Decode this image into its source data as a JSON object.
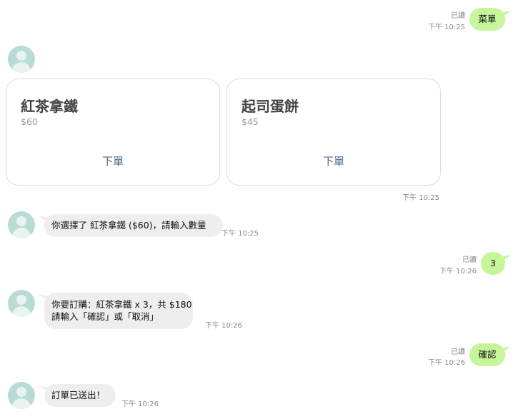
{
  "messages": {
    "out1": {
      "text": "菜單",
      "read": "已讀",
      "time": "下午 10:25"
    },
    "menu": {
      "cards": [
        {
          "title": "紅茶拿鐵",
          "price": "$60",
          "button": "下單"
        },
        {
          "title": "起司蛋餅",
          "price": "$45",
          "button": "下單"
        }
      ],
      "time": "下午 10:25"
    },
    "in1": {
      "text": "你選擇了 紅茶拿鐵 ($60)，請輸入數量",
      "time": "下午 10:25"
    },
    "out2": {
      "text": "3",
      "read": "已讀",
      "time": "下午 10:26"
    },
    "in2": {
      "line1": "你要訂購：紅茶拿鐵 x 3，共 $180",
      "line2": "請輸入「確認」或「取消」",
      "time": "下午 10:26"
    },
    "out3": {
      "text": "確認",
      "read": "已讀",
      "time": "下午 10:26"
    },
    "in3": {
      "text": "訂單已送出！",
      "time": "下午 10:26"
    }
  },
  "colors": {
    "outgoing_bubble": "#c6f59a",
    "incoming_bubble": "#eeeeee",
    "avatar": "#b8dcd4",
    "card_button": "#4a6a8a"
  },
  "icons": {
    "avatar": "user-avatar-icon"
  }
}
